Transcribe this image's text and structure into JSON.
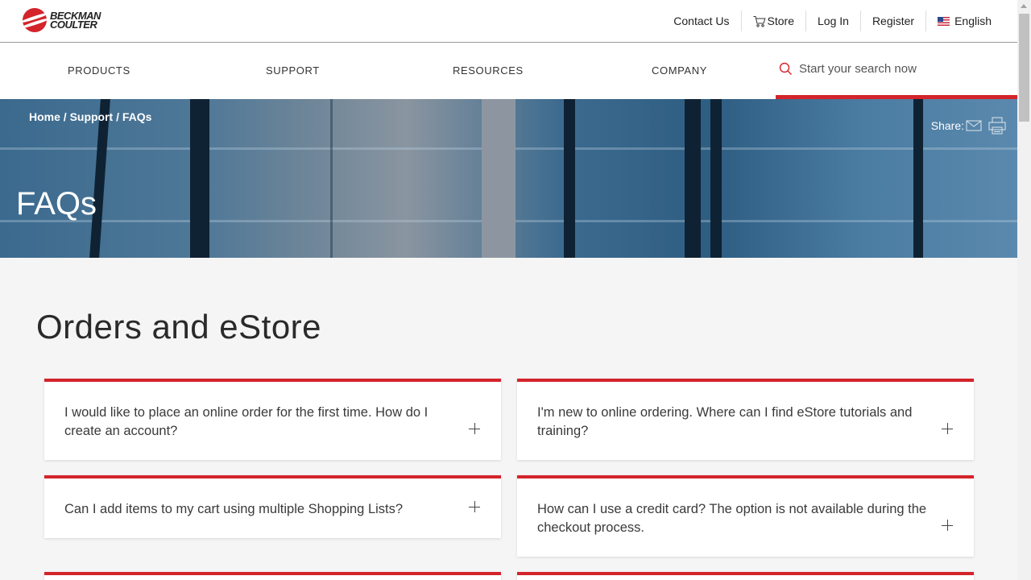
{
  "brand": {
    "line1": "BECKMAN",
    "line2": "COULTER"
  },
  "util_nav": {
    "contact": "Contact Us",
    "store": "Store",
    "login": "Log In",
    "register": "Register",
    "language": "English"
  },
  "main_nav": {
    "products": "PRODUCTS",
    "support": "SUPPORT",
    "resources": "RESOURCES",
    "company": "COMPANY",
    "search_placeholder": "Start your search now"
  },
  "hero": {
    "breadcrumb": "Home / Support / FAQs",
    "share_label": "Share:",
    "title": "FAQs"
  },
  "section": {
    "title": "Orders and eStore",
    "faqs": [
      {
        "question": "I would like to place an online order for the first time. How do I create an account?"
      },
      {
        "question": "I'm new to online ordering. Where can I find eStore tutorials and training?"
      },
      {
        "question": "Can I add items to my cart using multiple Shopping Lists?"
      },
      {
        "question": "How can I use a credit card? The option is not available during the checkout process."
      }
    ]
  },
  "colors": {
    "accent": "#d4242b",
    "hero_blue": "#3d6b8f"
  }
}
